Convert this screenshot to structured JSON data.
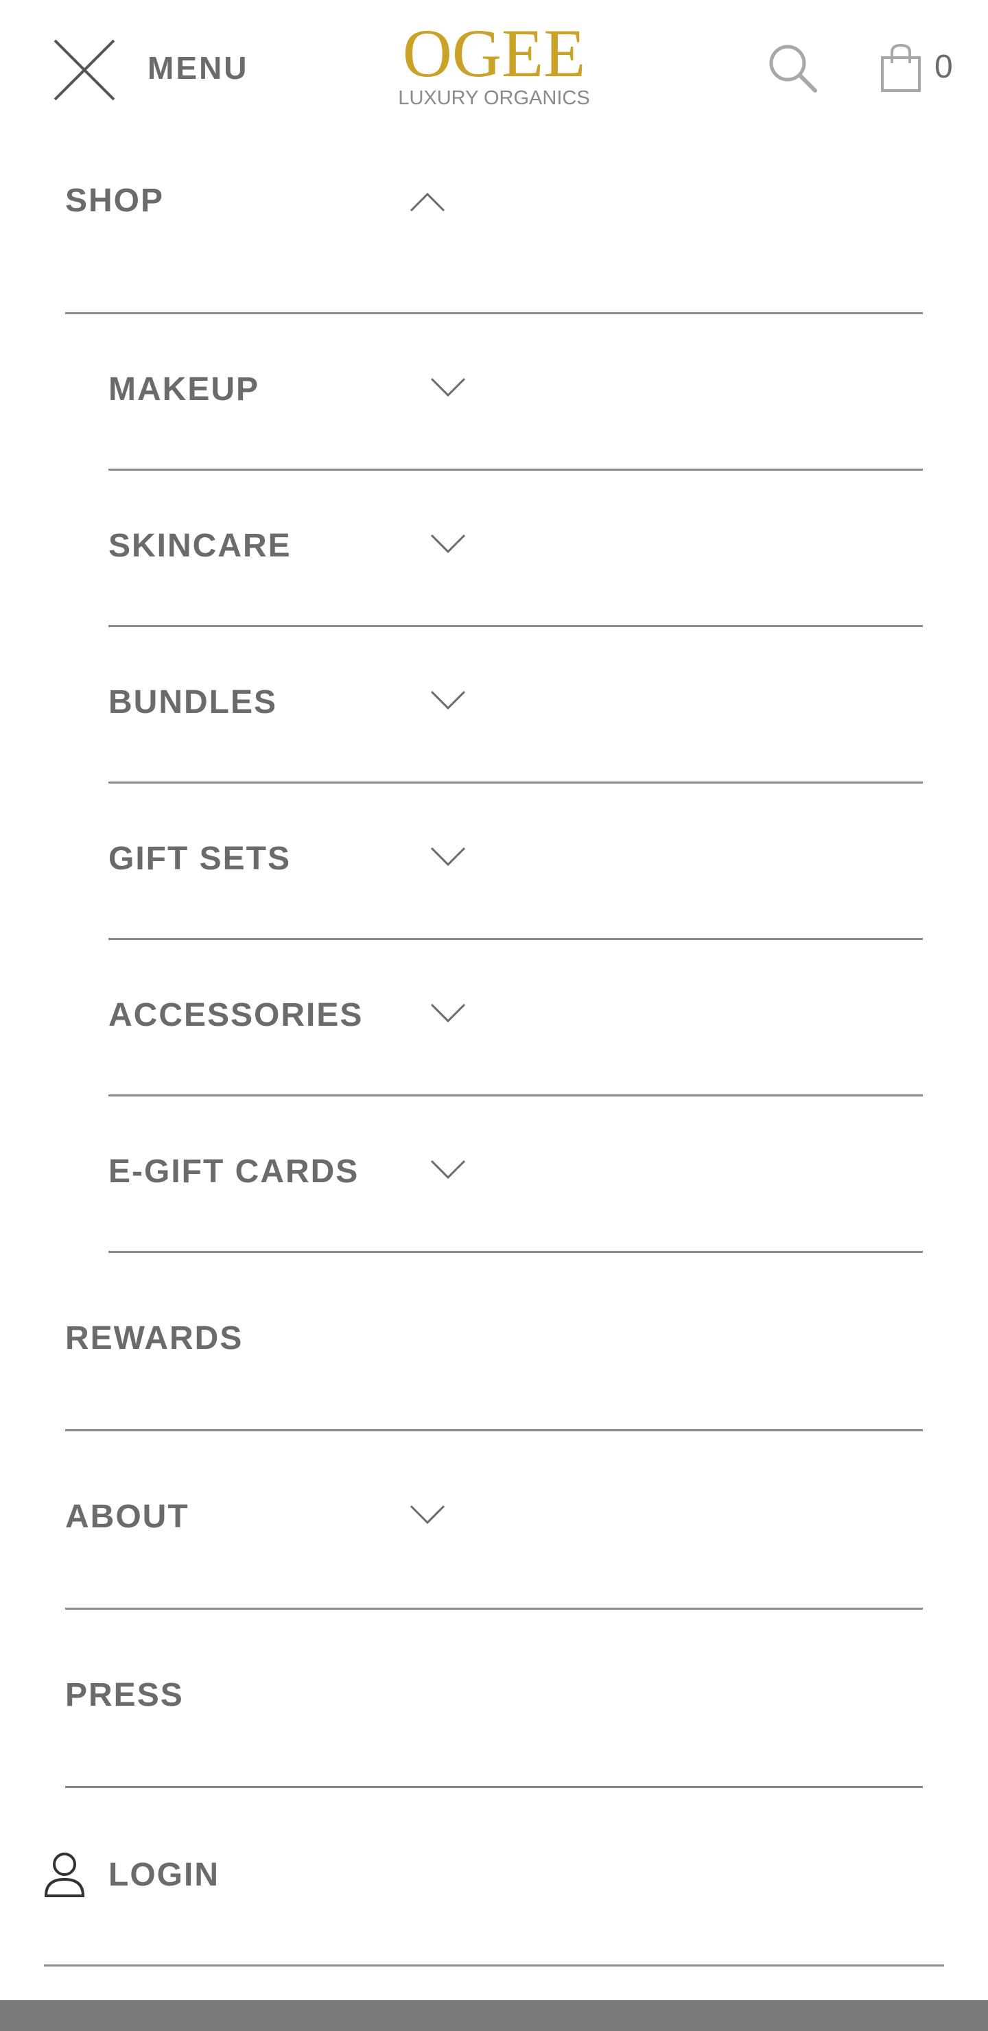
{
  "header": {
    "menu_label": "MENU",
    "logo_word": "OGEE",
    "logo_sub": "LUXURY ORGANICS",
    "cart_count": "0"
  },
  "nav": {
    "shop": "SHOP",
    "sub": [
      "MAKEUP",
      "SKINCARE",
      "BUNDLES",
      "GIFT SETS",
      "ACCESSORIES",
      "E-GIFT CARDS"
    ],
    "rewards": "REWARDS",
    "about": "ABOUT",
    "press": "PRESS",
    "login": "LOGIN"
  },
  "colors": {
    "logo_gold": "#c9a227",
    "text_gray": "#6b6b6b",
    "divider_gray": "#8a8a8a",
    "bottom_bar": "#7a7a7a"
  },
  "icons": [
    "close-icon",
    "search-icon",
    "shopping-bag-icon",
    "chevron-up-icon",
    "chevron-down-icon",
    "user-icon"
  ]
}
